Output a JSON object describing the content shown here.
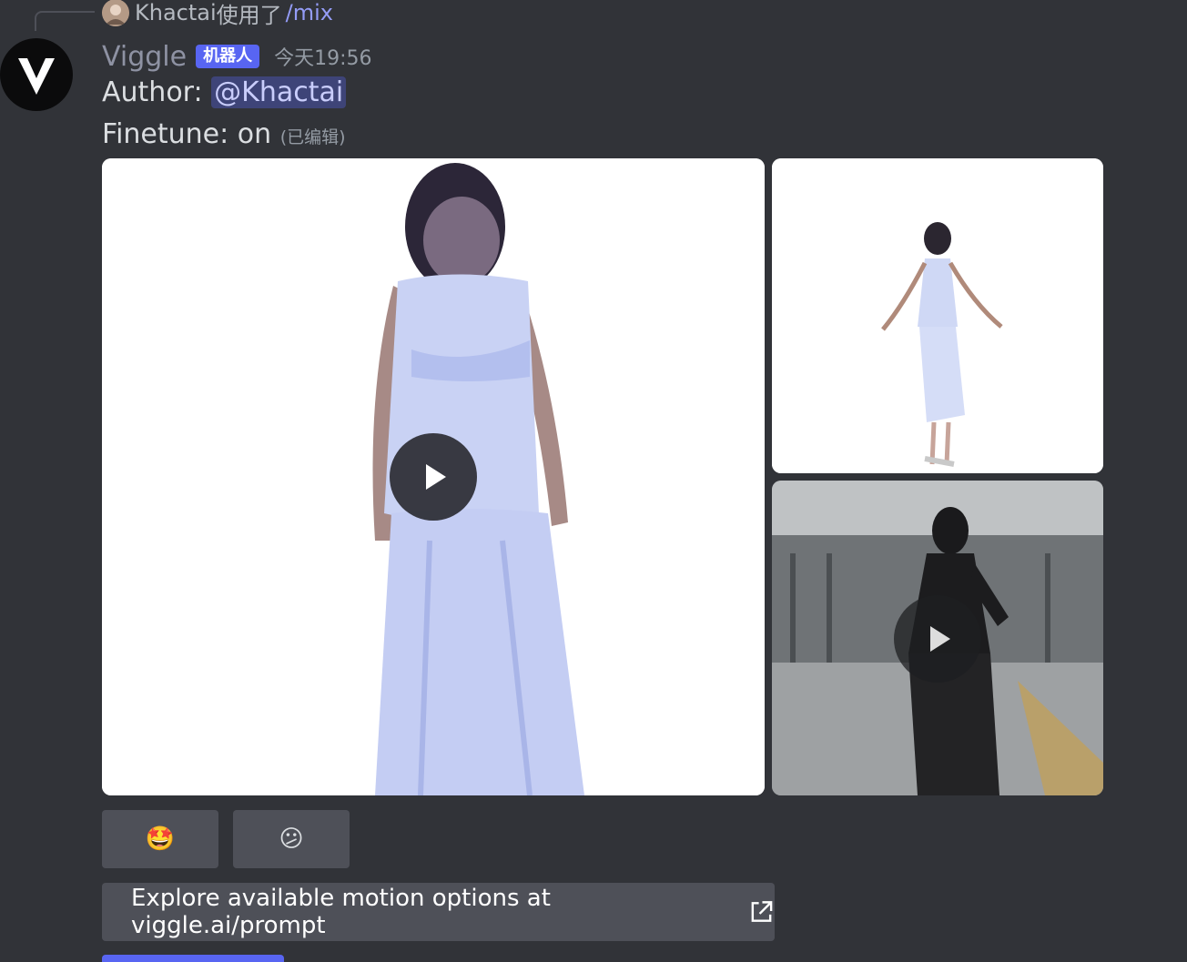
{
  "reply": {
    "username": "Khactai",
    "action": "使用了",
    "command": "/mix"
  },
  "message": {
    "username": "Viggle",
    "bot_tag": "机器人",
    "timestamp": "今天19:56",
    "author_label": "Author:",
    "author_mention": "@Khactai",
    "finetune_text": "Finetune: on",
    "edited_label": "(已编辑)"
  },
  "buttons": {
    "reaction_1": "🤩",
    "reaction_2": "😕",
    "link_label": "Explore available motion options at viggle.ai/prompt"
  },
  "icons": {
    "avatar": "viggle-logo-icon",
    "play": "play-icon",
    "external": "external-link-icon"
  }
}
